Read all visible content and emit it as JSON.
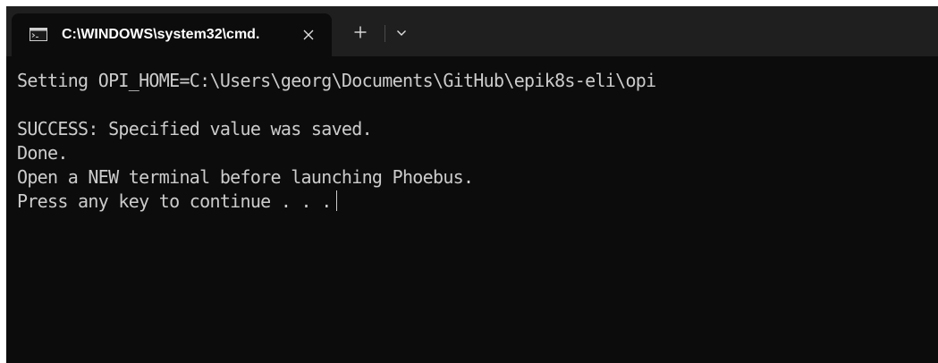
{
  "tab": {
    "title": "C:\\WINDOWS\\system32\\cmd.",
    "icon": "cmd-icon",
    "close_icon": "close-icon"
  },
  "toolbar": {
    "new_tab_icon": "plus-icon",
    "dropdown_icon": "chevron-down-icon"
  },
  "terminal": {
    "lines": [
      "Setting OPI_HOME=C:\\Users\\georg\\Documents\\GitHub\\epik8s-eli\\opi",
      "",
      "SUCCESS: Specified value was saved.",
      "Done.",
      "Open a NEW terminal before launching Phoebus.",
      "Press any key to continue . . ."
    ]
  },
  "colors": {
    "tab_bar_bg": "#1f1f1f",
    "terminal_bg": "#0c0c0c",
    "terminal_text": "#cccccc",
    "tab_title_text": "#ffffff"
  }
}
